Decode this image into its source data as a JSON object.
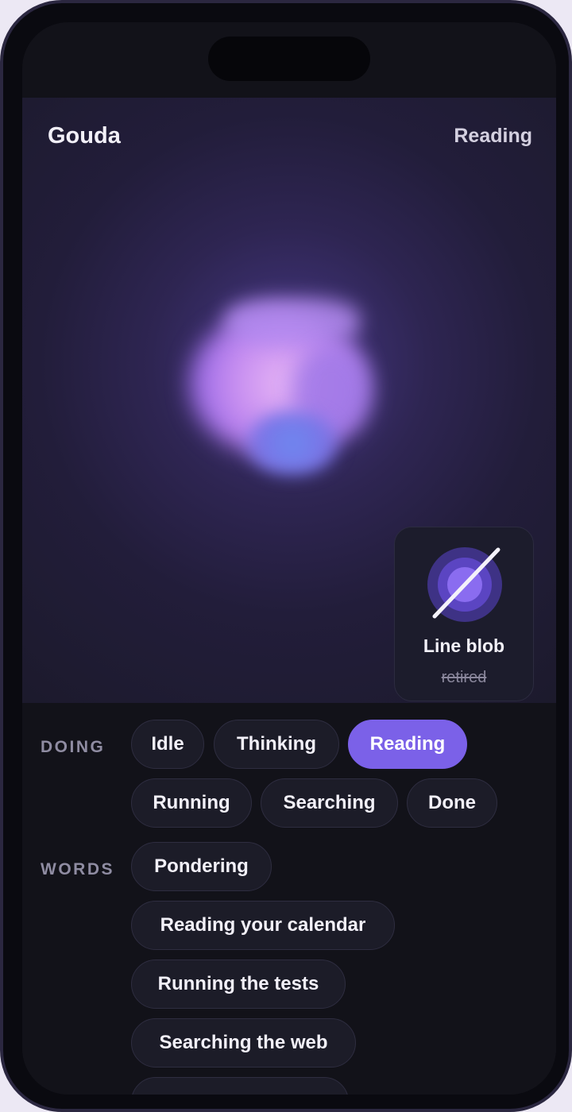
{
  "header": {
    "app_name": "Gouda",
    "state_label": "Reading"
  },
  "card": {
    "title": "Line blob",
    "subtitle": "retired",
    "icon": "line-blob-icon"
  },
  "doing": {
    "label": "DOING",
    "options": [
      "Idle",
      "Thinking",
      "Reading",
      "Running",
      "Searching",
      "Done"
    ],
    "selected": "Reading"
  },
  "words": {
    "label": "WORDS",
    "options": [
      "Pondering",
      "Reading your calendar",
      "Running the tests",
      "Searching the web"
    ]
  },
  "colors": {
    "accent": "#7b61e8",
    "background": "#121219",
    "chip": "#1c1c28",
    "blob": "#c58cf0"
  }
}
